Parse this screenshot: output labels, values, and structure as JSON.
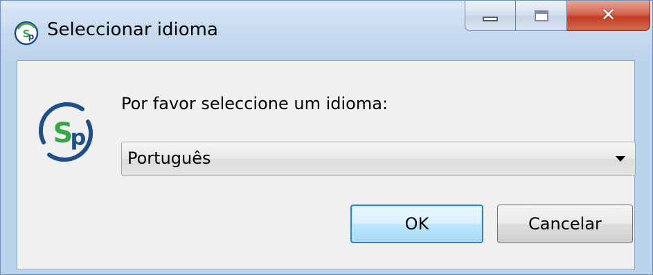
{
  "window": {
    "title": "Seleccionar idioma",
    "icon": "sp-app-icon",
    "controls": {
      "minimize": "minimize-icon",
      "maximize": "maximize-icon",
      "close": "close-icon"
    }
  },
  "dialog": {
    "prompt": "Por favor seleccione um idioma:",
    "language_select": {
      "value": "Português"
    },
    "buttons": {
      "ok": "OK",
      "cancel": "Cancelar"
    }
  },
  "colors": {
    "logo_green": "#3aa84a",
    "logo_blue": "#1f4f88",
    "close_red": "#c23e25",
    "ok_focus": "#3c7fb1"
  }
}
